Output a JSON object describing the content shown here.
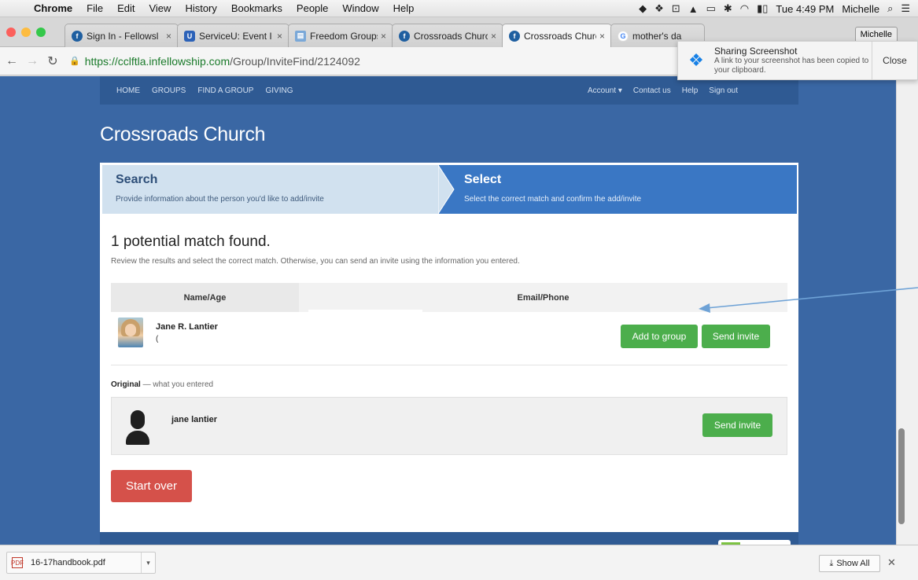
{
  "menubar": {
    "app": "Chrome",
    "items": [
      "File",
      "Edit",
      "View",
      "History",
      "Bookmarks",
      "People",
      "Window",
      "Help"
    ],
    "clock": "Tue 4:49 PM",
    "user": "Michelle"
  },
  "tabs": [
    {
      "label": "Sign In - Fellowsl",
      "icon": "fellowship-icon"
    },
    {
      "label": "ServiceU: Event I",
      "icon": "serviceu-icon"
    },
    {
      "label": "Freedom Groups",
      "icon": "sheet-icon"
    },
    {
      "label": "Crossroads Churc",
      "icon": "fellowship-icon"
    },
    {
      "label": "Crossroads Churc",
      "icon": "fellowship-icon",
      "active": true
    },
    {
      "label": "mother's da",
      "icon": "google-icon"
    }
  ],
  "profile_button": "Michelle",
  "address": {
    "host": "https://cclftla.infellowship.com",
    "path": "/Group/InviteFind/2124092"
  },
  "notification": {
    "title": "Sharing Screenshot",
    "text": "A link to your screenshot has been copied to your clipboard.",
    "close": "Close"
  },
  "site_nav": {
    "left": [
      "HOME",
      "GROUPS",
      "FIND A GROUP",
      "GIVING"
    ],
    "right": [
      "Account ▾",
      "Contact us",
      "Help",
      "Sign out"
    ]
  },
  "church_name": "Crossroads Church",
  "steps": {
    "search_title": "Search",
    "search_sub": "Provide information about the person you'd like to add/invite",
    "select_title": "Select",
    "select_sub": "Select the correct match and confirm the add/invite"
  },
  "results": {
    "heading": "1 potential match found.",
    "subheading": "Review the results and select the correct match. Otherwise, you can send an invite using the information you entered.",
    "col_name": "Name/Age",
    "col_email": "Email/Phone",
    "match_name": "Jane R. Lantier",
    "match_detail": "(",
    "add_btn": "Add to group",
    "invite_btn": "Send invite"
  },
  "original": {
    "label": "Original",
    "label_rest": "— what you entered",
    "name": "jane lantier",
    "invite_btn": "Send invite"
  },
  "start_over": "Start over",
  "downloads": {
    "file": "16-17handbook.pdf",
    "show_all": "Show All"
  },
  "colors": {
    "page_bg": "#3a67a4",
    "step_active": "#3a77c4",
    "green_button": "#4cae4c",
    "red_button": "#d5514a",
    "annotation_arrow": "#6ea2d6"
  }
}
